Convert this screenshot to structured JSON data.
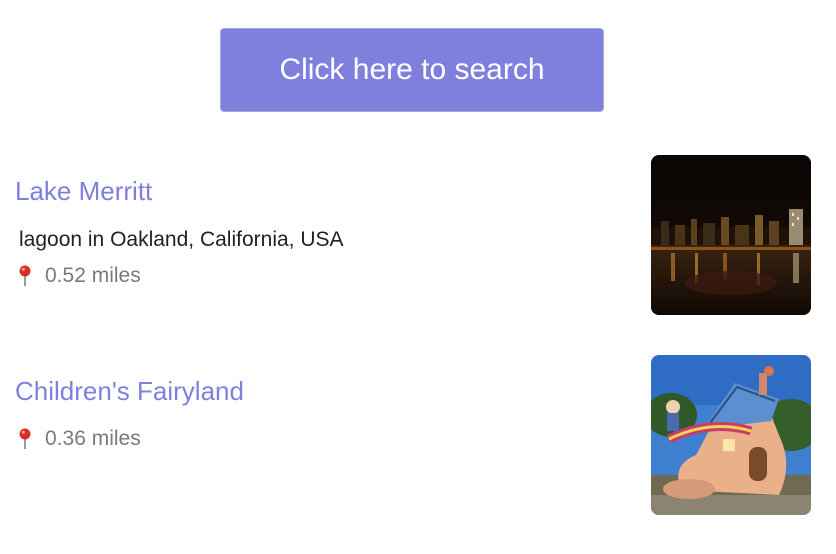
{
  "search": {
    "button_label": "Click here to search"
  },
  "results": [
    {
      "title": "Lake Merritt",
      "description": "lagoon in Oakland, California, USA",
      "distance": "0.52 miles",
      "pin_icon": "map-pin-icon",
      "thumbnail": "night-lake-skyline-photo"
    },
    {
      "title": "Children's Fairyland",
      "description": "",
      "distance": "0.36 miles",
      "pin_icon": "map-pin-icon",
      "thumbnail": "fairyland-shoe-house-photo"
    }
  ],
  "colors": {
    "accent": "#7f80de",
    "pin": "#d93025",
    "distance_text": "#7a7a7a"
  }
}
